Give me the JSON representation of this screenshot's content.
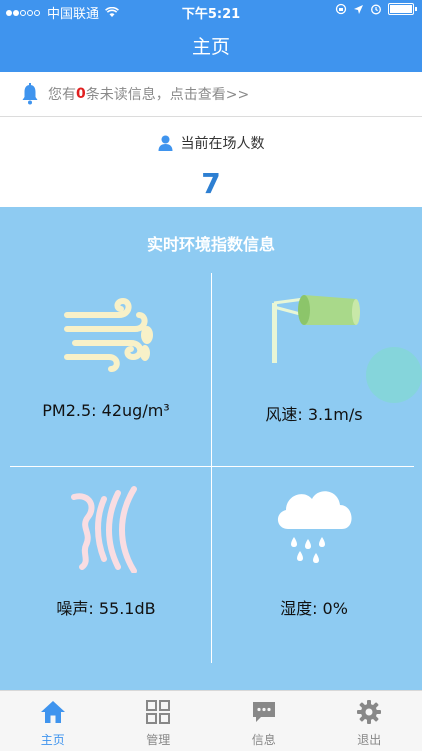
{
  "status_bar": {
    "carrier": "中国联通",
    "time": "下午5:21"
  },
  "nav": {
    "title": "主页"
  },
  "notice": {
    "prefix": "您有",
    "count": "0",
    "suffix": "条未读信息，点击查看>>"
  },
  "people": {
    "label": "当前在场人数",
    "count": "7"
  },
  "environment": {
    "title": "实时环境指数信息",
    "pm25": "PM2.5: 42ug/m³",
    "wind": "风速: 3.1m/s",
    "noise": "噪声: 55.1dB",
    "humidity": "湿度: 0%"
  },
  "tabs": [
    {
      "label": "主页",
      "icon": "home-icon",
      "active": true
    },
    {
      "label": "管理",
      "icon": "grid-icon",
      "active": false
    },
    {
      "label": "信息",
      "icon": "message-icon",
      "active": false
    },
    {
      "label": "退出",
      "icon": "gear-icon",
      "active": false
    }
  ],
  "colors": {
    "primary": "#3f94ee",
    "env_bg": "#8ecbf2",
    "alert": "#e02020"
  }
}
